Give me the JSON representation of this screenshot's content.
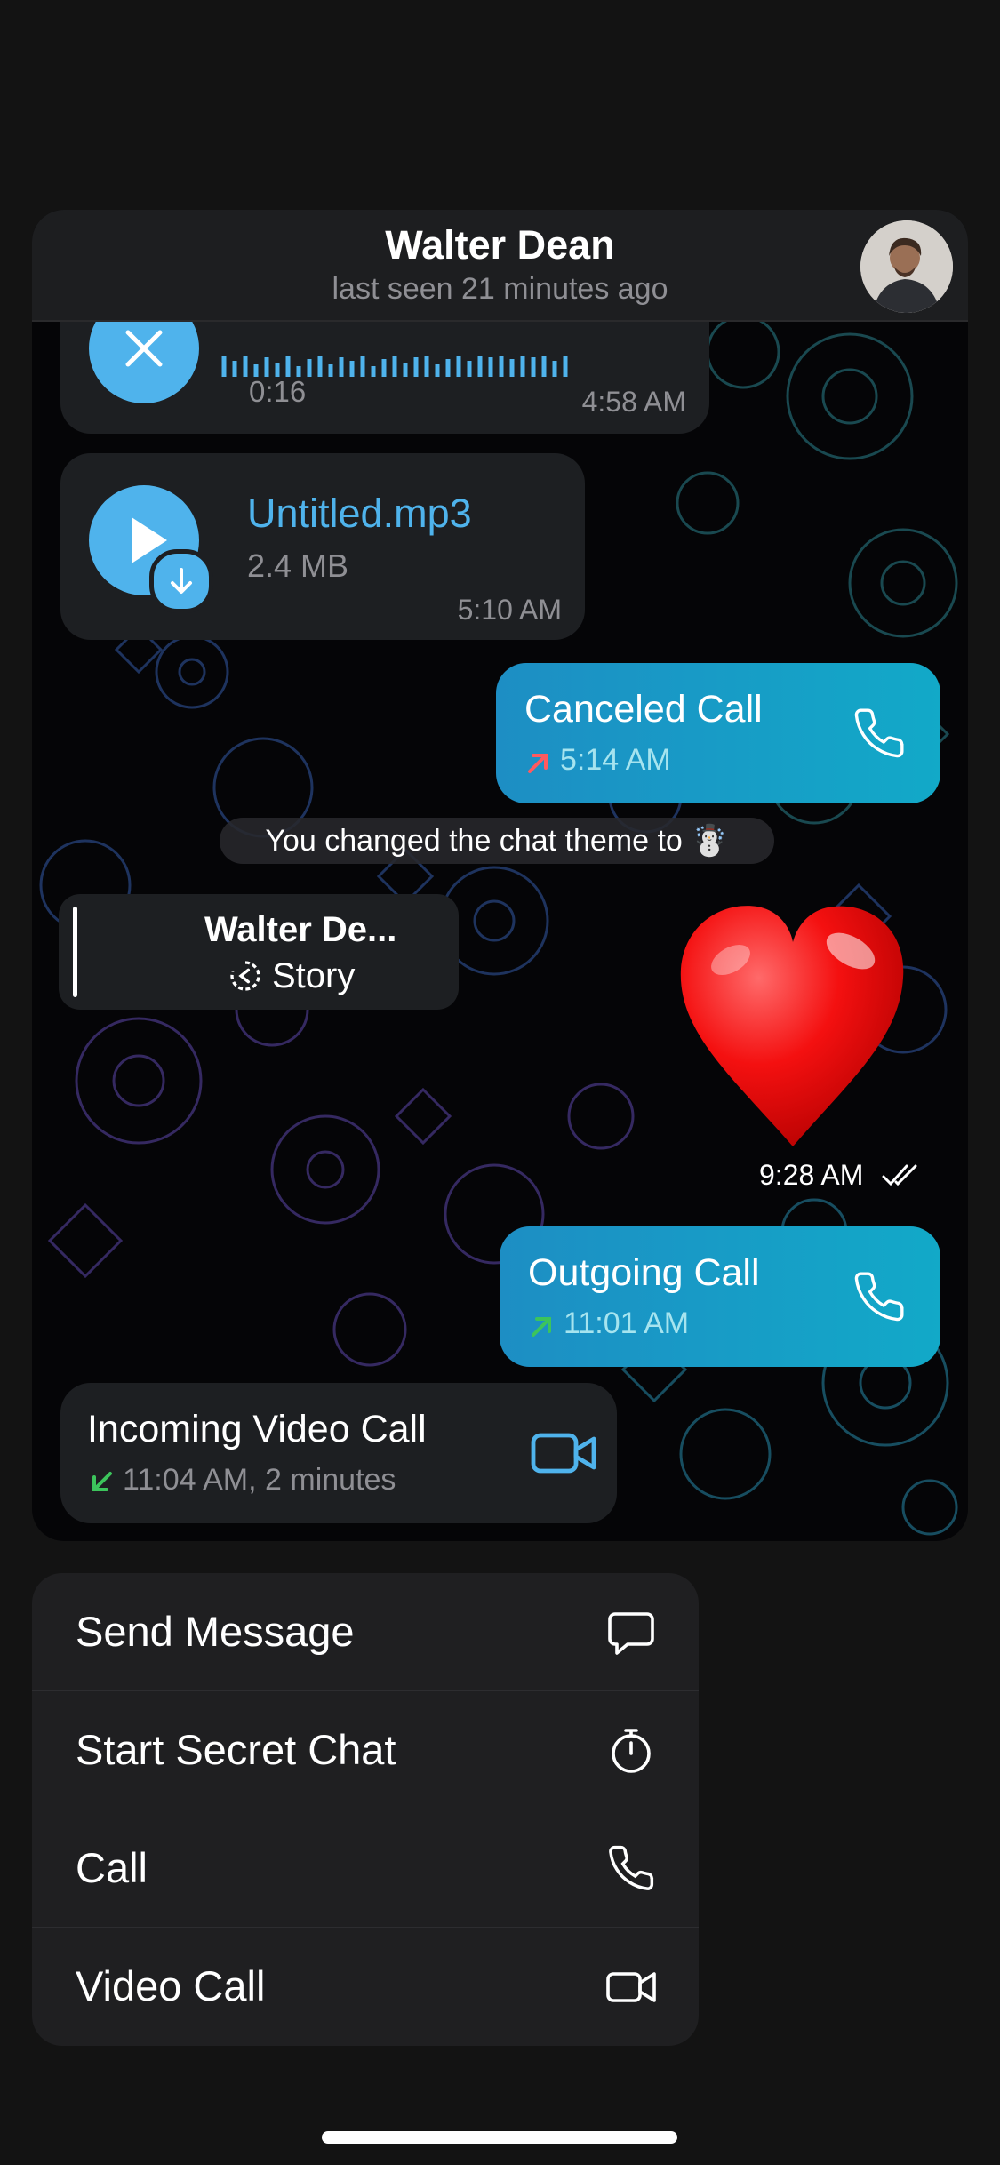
{
  "header": {
    "name": "Walter Dean",
    "status": "last seen 21 minutes ago"
  },
  "messages": {
    "voice": {
      "duration": "0:16",
      "time": "4:58 AM"
    },
    "file": {
      "name": "Untitled.mp3",
      "size": "2.4 MB",
      "time": "5:10 AM"
    },
    "canceled_call": {
      "title": "Canceled Call",
      "time": "5:14 AM"
    },
    "service": {
      "text": "You changed the chat theme to ☃️"
    },
    "story": {
      "title": "Walter De...",
      "label": "Story"
    },
    "sticker": {
      "time": "9:28 AM"
    },
    "outgoing_call": {
      "title": "Outgoing Call",
      "time": "11:01 AM"
    },
    "incoming_video": {
      "title": "Incoming Video Call",
      "time": "11:04 AM, 2 minutes"
    }
  },
  "menu": {
    "items": [
      {
        "label": "Send Message",
        "icon": "message-icon"
      },
      {
        "label": "Start Secret Chat",
        "icon": "timer-icon"
      },
      {
        "label": "Call",
        "icon": "phone-icon"
      },
      {
        "label": "Video Call",
        "icon": "video-icon"
      }
    ]
  },
  "colors": {
    "accent": "#4fb3ec",
    "outgoing_bubble": "#12a9c8",
    "incoming_bubble": "#1d1f22",
    "missed_red": "#ff5a5f",
    "success_green": "#3cc45c"
  }
}
